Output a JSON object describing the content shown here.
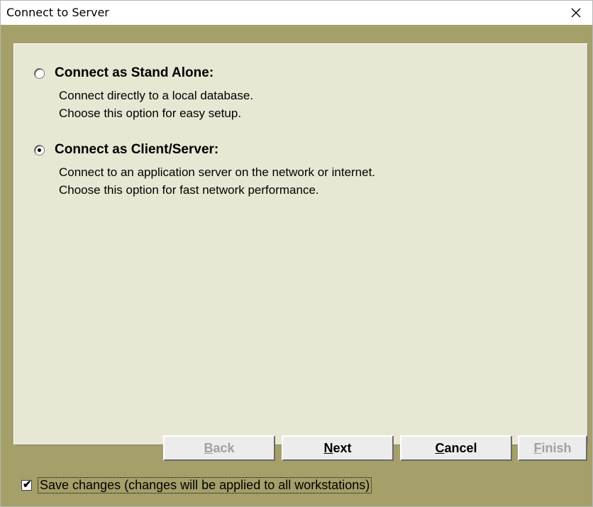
{
  "window": {
    "title": "Connect to Server",
    "close_glyph": "✕"
  },
  "options": [
    {
      "title": "Connect as Stand Alone:",
      "desc_line1": "Connect directly to a local database.",
      "desc_line2": "Choose this option for easy setup.",
      "selected": false
    },
    {
      "title": "Connect as Client/Server:",
      "desc_line1": "Connect to an application server on the network or internet.",
      "desc_line2": "Choose this option for fast network performance.",
      "selected": true
    }
  ],
  "buttons": {
    "back": {
      "mnemonic": "B",
      "rest": "ack",
      "enabled": false
    },
    "next": {
      "mnemonic": "N",
      "rest": "ext",
      "enabled": true
    },
    "cancel": {
      "mnemonic": "C",
      "rest": "ancel",
      "enabled": true
    },
    "finish": {
      "mnemonic": "F",
      "rest": "inish",
      "enabled": false
    }
  },
  "save_changes": {
    "label": "Save changes (changes will be applied to all workstations)",
    "checked": true,
    "check_glyph": "✔"
  },
  "colors": {
    "dialog_background": "#a59f69",
    "panel_background": "#e8e7d4",
    "button_face": "#ececec",
    "disabled_text": "#a0a0a0"
  }
}
